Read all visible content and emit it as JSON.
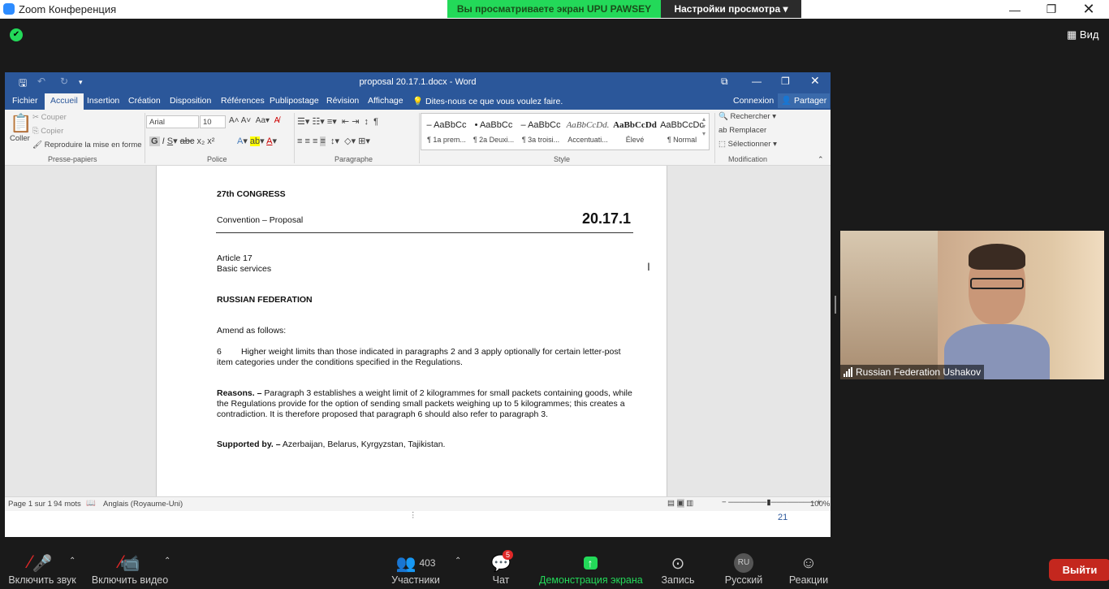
{
  "zoom": {
    "app_title": "Zoom Конференция",
    "share_message": "Вы просматриваете экран UPU PAWSEY",
    "view_options": "Настройки просмотра ▾",
    "view_button": "Вид"
  },
  "word": {
    "title": "proposal 20.17.1.docx - Word",
    "tabs": [
      "Fichier",
      "Accueil",
      "Insertion",
      "Création",
      "Disposition",
      "Références",
      "Publipostage",
      "Révision",
      "Affichage"
    ],
    "tell_me": "Dites-nous ce que vous voulez faire.",
    "connexion": "Connexion",
    "partager": "Partager",
    "clipboard": {
      "coller": "Coller",
      "couper": "Couper",
      "copier": "Copier",
      "reproduire": "Reproduire la mise en forme",
      "group": "Presse-papiers"
    },
    "font": {
      "name": "Arial",
      "size": "10",
      "group": "Police"
    },
    "paragraph_group": "Paragraphe",
    "styles": {
      "group": "Style",
      "items": [
        {
          "preview": "– AaBbCc",
          "name": "¶ 1a prem..."
        },
        {
          "preview": "• AaBbCc",
          "name": "¶ 2a Deuxi..."
        },
        {
          "preview": "– AaBbCc",
          "name": "¶ 3a troisi..."
        },
        {
          "preview": "AaBbCcDd.",
          "name": "Accentuati..."
        },
        {
          "preview": "AaBbCcDd",
          "name": "Élevé"
        },
        {
          "preview": "AaBbCcDc",
          "name": "¶ Normal"
        }
      ]
    },
    "editing": {
      "find": "Rechercher",
      "replace": "Remplacer",
      "select": "Sélectionner",
      "group": "Modification"
    },
    "document": {
      "congress": "27th CONGRESS",
      "convention": "Convention – Proposal",
      "number": "20.17.1",
      "article": "Article 17",
      "article_title": "Basic services",
      "country": "RUSSIAN FEDERATION",
      "amend": "Amend as follows:",
      "para_num": "6",
      "para_line1": "Higher weight limits than those indicated in paragraphs 2 and 3 apply optionally for certain letter-post",
      "para_line2": "item categories under the conditions specified in the Regulations.",
      "reasons_label": "Reasons. –",
      "reasons_line1": " Paragraph 3 establishes a weight limit of 2 kilogrammes for small packets containing goods, while",
      "reasons_line2": "the Regulations provide for the option of sending small packets weighing up to 5 kilogrammes; this creates a",
      "reasons_line3": "contradiction. It is therefore proposed that paragraph 6 should also refer to paragraph 3.",
      "supported_label": "Supported by. –",
      "supported_text": " Azerbaijan, Belarus, Kyrgyzstan, Tajikistan."
    },
    "status": {
      "page": "Page 1 sur 1",
      "words": "94 mots",
      "language": "Anglais (Royaume-Uni)",
      "zoom": "100%"
    },
    "page_number": "21"
  },
  "video": {
    "participant": "Russian Federation Ushakov"
  },
  "toolbar": {
    "audio": "Включить звук",
    "video": "Включить видео",
    "participants": "Участники",
    "participants_count": "403",
    "chat": "Чат",
    "chat_badge": "5",
    "share": "Демонстрация экрана",
    "record": "Запись",
    "language": "Русский",
    "language_code": "RU",
    "reactions": "Реакции",
    "exit": "Выйти"
  }
}
